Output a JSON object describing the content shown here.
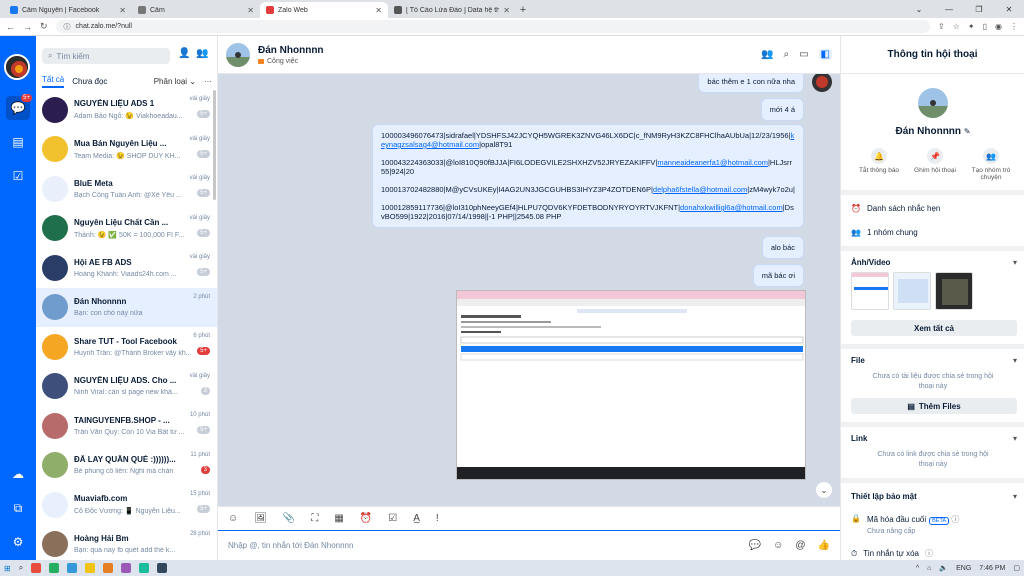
{
  "browser": {
    "tabs": [
      {
        "title": "Cẩm Nguyễn | Facebook",
        "color": "#1877f2",
        "active": false
      },
      {
        "title": "Cẩm",
        "color": "#777777",
        "active": false
      },
      {
        "title": "Zalo Web",
        "color": "#e13b3b",
        "active": true
      },
      {
        "title": "[ Tố Cáo Lừa Đảo ] Data hệ thống",
        "color": "#555555",
        "active": false
      }
    ],
    "url": "chat.zalo.me/?null"
  },
  "sidebar": {
    "messages_badge": "5+"
  },
  "conversations": {
    "search_placeholder": "Tìm kiếm",
    "filter_all": "Tất cả",
    "filter_unread": "Chưa đọc",
    "classify": "Phân loại",
    "items": [
      {
        "name": "NGUYỄN LIỆU ADS 1",
        "preview": "Adam Bảo Ngô: 😉 Viakhoeadau...",
        "time": "vài giây",
        "count": "5+",
        "red": false,
        "color": "#2b1d4f"
      },
      {
        "name": "Mua Bán Nguyên Liệu ...",
        "preview": "Team Media: 😉 SHOP DUY KH...",
        "time": "vài giây",
        "count": "5+",
        "red": false,
        "color": "#f2c12e"
      },
      {
        "name": "BluE Meta",
        "preview": "Bạch Công Tuấn Anh: @Xế Yêu ...",
        "time": "vài giây",
        "count": "5+",
        "red": false,
        "color": "#e9f0fb"
      },
      {
        "name": "Nguyên Liệu Chất Cần ...",
        "preview": "Thành: 😉 ✅ 50K = 100,000 FI F...",
        "time": "vài giây",
        "count": "5+",
        "red": false,
        "color": "#1f6f4a"
      },
      {
        "name": "Hội AE FB ADS",
        "preview": "Hoàng Khánh: Viaads24h.com ...",
        "time": "vài giây",
        "count": "5+",
        "red": false,
        "color": "#2a3d66"
      },
      {
        "name": "Đán Nhonnnn",
        "preview": "Bạn: con chó này nữa",
        "time": "2 phút",
        "count": "",
        "red": false,
        "color": "#6f9ccc"
      },
      {
        "name": "Share TUT - Tool Facebook",
        "preview": "Huynh Trần: @Thành Broker vậy kh...",
        "time": "6 phút",
        "count": "5+",
        "red": true,
        "color": "#f5a623"
      },
      {
        "name": "NGUYÊN LIỆU ADS. Cho ...",
        "preview": "Ninh Viral: cần sl page new khá...",
        "time": "vài giây",
        "count": "3",
        "red": false,
        "color": "#3d4f7a"
      },
      {
        "name": "TAINGUYENFB.SHOP - ...",
        "preview": "Trần Văn Quý: Còn 10 Via Bất tử ...",
        "time": "10 phút",
        "count": "5+",
        "red": false,
        "color": "#b76b6b"
      },
      {
        "name": "ĐÃ LAY QUẦN QUÈ :))))))...",
        "preview": "Bé phung cô liên: Nghỉ mà chán",
        "time": "11 phút",
        "count": "3",
        "red": true,
        "color": "#8fae6a"
      },
      {
        "name": "Muaviafb.com",
        "preview": "Cô Độc Vương: 📱 Nguyễn Liệu...",
        "time": "15 phút",
        "count": "5+",
        "red": false,
        "color": "#e8f0fe"
      },
      {
        "name": "Hoàng Hải Bm",
        "preview": "Bạn: qua nay fb quét add thẻ k...",
        "time": "28 phút",
        "count": "",
        "red": false,
        "color": "#8a6f5a"
      }
    ]
  },
  "chat": {
    "name": "Đán Nhonnnn",
    "tag": "Công việc",
    "messages": {
      "m1": "bác thêm e 1 con nữa nha",
      "m2": "mới 4 á",
      "data1a": "100003496076473|sidrafael|YDSHFSJ42JCYQH5WGREK3ZNVG46LX6DC|c_fNM9RyH3KZC8FHClhaAUbUa|12/23/1956|",
      "data1link": "keynagzsalsag4@hotmail.com",
      "data1b": "|opal8T91",
      "data2a": "100043224363033|@loI810Q90fBJJA|FI6LODEGVILE2SHXHZV52JRYEZAKIFFV|",
      "data2link": "manneaideanerfa1@hotmail.com",
      "data2b": "|HLJsrr55|924|20",
      "data3a": "100013702482880|M@yCVsUKEy|I4AG2UN3JGCGUHBS3IHYZ3P4ZOTDEN6P|",
      "data3link": "delpha6fstella@hotmail.com",
      "data3b": "|zM4wyk7o2u|",
      "data4a": "100012859117736|@loI310phNeeyGEf4|HLPU7QDV6KYFDETBODNYRYOYRTVJKFNT|",
      "data4link": "donahxkwilligl6a@hotmail.com",
      "data4b": "|DsvBO599|1922|2016|07/14/1998||-1 PHP||2545.08 PHP",
      "m3": "alo bác",
      "m4": "mã bác ơi"
    },
    "input_placeholder": "Nhập @, tin nhắn tới Đán Nhonnnn"
  },
  "info": {
    "title": "Thông tin hội thoại",
    "name": "Đán Nhonnnn",
    "actions": {
      "mute": "Tắt thông báo",
      "pin": "Ghim hội thoại",
      "group": "Tạo nhóm trò chuyện"
    },
    "reminders": "Danh sách nhắc hẹn",
    "groups": "1 nhóm chung",
    "media": "Ảnh/Video",
    "see_all": "Xem tất cả",
    "file": "File",
    "file_empty": "Chưa có tài liệu được chia sẻ trong hội thoại này",
    "more_files": "Thêm Files",
    "link": "Link",
    "link_empty": "Chưa có link được chia sẻ trong hội thoại này",
    "security": "Thiết lập bảo mật",
    "e2e": "Mã hóa đầu cuối",
    "beta": "BETA",
    "e2e_status": "Chưa nâng cấp",
    "self_destruct": "Tin nhắn tự xóa"
  },
  "taskbar": {
    "lang": "ENG",
    "time": "7:46 PM"
  }
}
